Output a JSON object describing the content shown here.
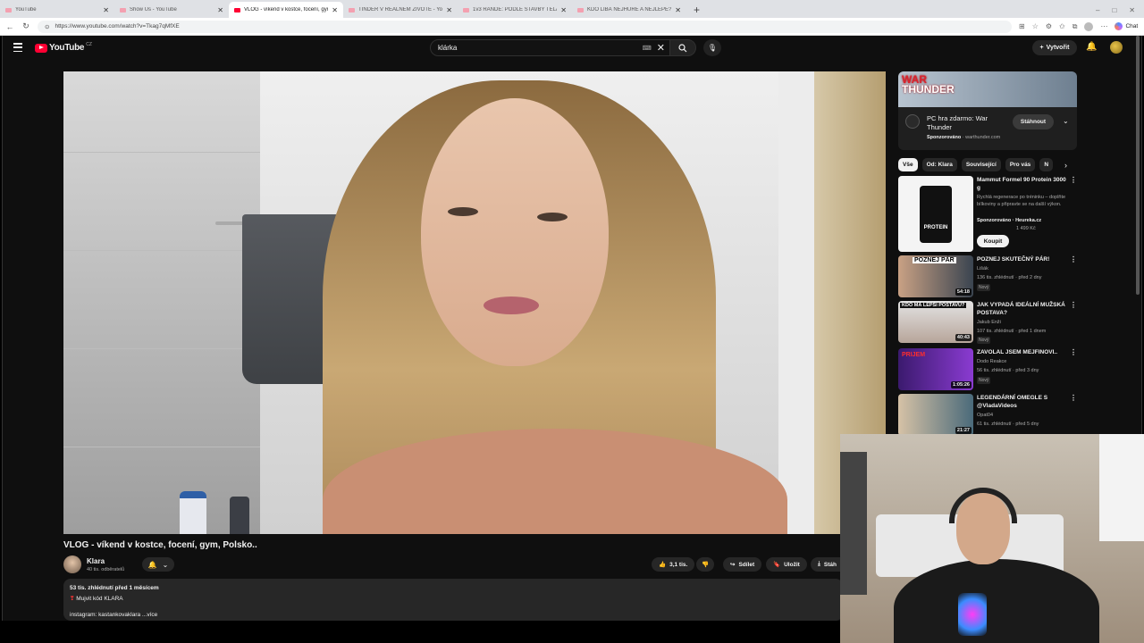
{
  "browser": {
    "tabs": [
      {
        "label": "YouTube",
        "active": false,
        "icon": "youtube-favicon"
      },
      {
        "label": "Show Us - YouTube",
        "active": false,
        "icon": "youtube-favicon"
      },
      {
        "label": "VLOG - víkend v kostce, focení, gym",
        "active": true,
        "icon": "youtube-favicon"
      },
      {
        "label": "TINDER V REÁLNÉM ŽIVOTĚ - You",
        "active": false,
        "icon": "youtube-favicon"
      },
      {
        "label": "1v3 RANDE: PODLE STAVBY TĚLA",
        "active": false,
        "icon": "youtube-favicon"
      },
      {
        "label": "KDO LIBÁ NEJHŮŘE A NEJLÉPE?",
        "active": false,
        "icon": "youtube-favicon"
      }
    ],
    "new_tab": "+",
    "window_controls": [
      "–",
      "□",
      "✕"
    ],
    "url": "https://www.youtube.com/watch?v=Tkag7qMfXE",
    "chat_label": "Chat"
  },
  "youtube": {
    "logo_text": "YouTube",
    "logo_region": "CZ",
    "search_value": "klárka",
    "create_label": "Vytvořit",
    "video": {
      "title": "VLOG - víkend v kostce, focení, gym, Polsko..",
      "channel": "Klara",
      "subscribers": "40 tis. odběratelů",
      "likes": "3,1 tis.",
      "share": "Sdílet",
      "save": "Uložit",
      "download": "Stáh",
      "views_date": "53 tis. zhlédnutí  před 1 měsícem",
      "desc_line": "Mujvit kód KLARA",
      "desc_more": "instagram: kastankovaklara ...více"
    },
    "ad": {
      "banner_line1": "WAR",
      "banner_line2": "THUNDER",
      "title": "PC hra zdarmo: War Thunder",
      "sponsored": "Sponzorováno",
      "domain": "warthunder.com",
      "cta": "Stáhnout"
    },
    "chips": [
      "Vše",
      "Od: Klara",
      "Související",
      "Pro vás",
      "N"
    ],
    "recommendations": [
      {
        "title": "Mammut Formel 90 Protein 3000 g",
        "desc": "Rychlá regenerace po tréninku – doplňte bílkoviny a připravte se na další výkon.",
        "channel": "Sponzorováno · Heureka.cz",
        "meta": "1 499 Kč",
        "cta": "Koupit",
        "duration": ""
      },
      {
        "title": "POZNEJ SKUTEČNÝ PÁR!",
        "channel": "Lišák",
        "meta": "136 tis. zhlédnutí · před 2 dny",
        "badge": "Nový",
        "duration": "54:18"
      },
      {
        "title": "JAK VYPADÁ IDEÁLNÍ MUŽSKÁ POSTAVA?",
        "channel": "Jakub Enži",
        "meta": "107 tis. zhlédnutí · před 1 dnem",
        "badge": "Nový",
        "duration": "40:43"
      },
      {
        "title": "ZAVOLAL JSEM MEJFINOVI..",
        "channel": "Dodo Reakce",
        "meta": "56 tis. zhlédnutí · před 3 dny",
        "badge": "Nový",
        "duration": "1:05:26"
      },
      {
        "title": "LEGENDÁRNÍ OMEGLE S @VladaVideos",
        "channel": "Opat04",
        "meta": "61 tis. zhlédnutí · před 5 dny",
        "badge": "",
        "duration": "21:27"
      }
    ],
    "thumb_texts": {
      "r1": "PROTEIN",
      "r2": "POZNEJ PÁR",
      "r3": "KDO MÁ LEPŠÍ POSTAVU?",
      "r4": "PRIJEM"
    }
  }
}
